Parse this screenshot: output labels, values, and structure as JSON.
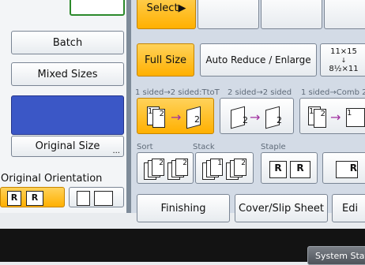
{
  "top": {
    "select_label": "Select▶"
  },
  "left": {
    "batch": "Batch",
    "mixed_sizes": "Mixed Sizes",
    "original_size": "Original Size",
    "original_size_more": "...",
    "orientation_title": "Original Orientation"
  },
  "reduce": {
    "full_size": "Full Size",
    "auto_reduce": "Auto Reduce / Enlarge",
    "ratio_top": "11×15",
    "ratio_bottom": "8½×11"
  },
  "duplex": {
    "label_1": "1 sided→2 sided:TtoT",
    "label_2": "2 sided→2 sided",
    "label_3": "1 sided→Comb 2"
  },
  "finish_labels": {
    "sort": "Sort",
    "stack": "Stack",
    "staple": "Staple"
  },
  "bottom": {
    "finishing": "Finishing",
    "cover_slip": "Cover/Slip Sheet",
    "edit": "Edi"
  },
  "status": {
    "system_status": "System Statu"
  },
  "colors": {
    "accent": "#ffbf1f",
    "panel": "#3b57c6",
    "main_bg": "#d3dbe6"
  }
}
